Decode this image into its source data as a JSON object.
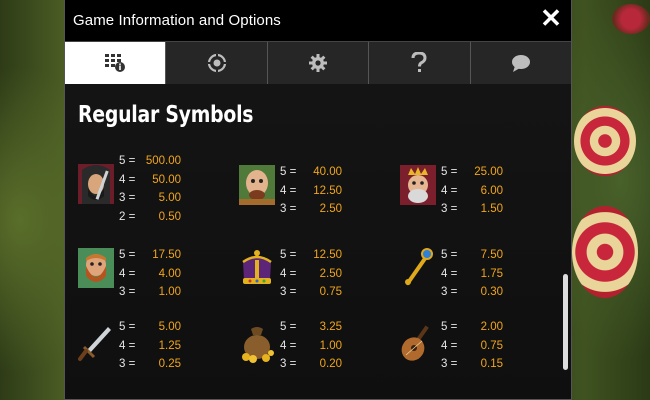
{
  "dialog": {
    "title": "Game Information and Options",
    "close_label": "✕"
  },
  "tabs": [
    {
      "name": "paytable",
      "icon": "paytable-icon",
      "active": true
    },
    {
      "name": "autoplay",
      "icon": "autoplay-icon",
      "active": false
    },
    {
      "name": "settings",
      "icon": "gear-icon",
      "active": false
    },
    {
      "name": "help",
      "icon": "question-icon",
      "active": false
    },
    {
      "name": "chat",
      "icon": "chat-bubble-icon",
      "active": false
    }
  ],
  "section": {
    "title": "Regular Symbols"
  },
  "symbols": [
    {
      "icon": "hooded-villain-symbol",
      "pays": [
        {
          "k": "5 =",
          "v": "500.00"
        },
        {
          "k": "4 =",
          "v": "50.00"
        },
        {
          "k": "3 =",
          "v": "5.00"
        },
        {
          "k": "2 =",
          "v": "0.50"
        }
      ]
    },
    {
      "icon": "bald-man-symbol",
      "pays": [
        {
          "k": "5 =",
          "v": "40.00"
        },
        {
          "k": "4 =",
          "v": "12.50"
        },
        {
          "k": "3 =",
          "v": "2.50"
        }
      ]
    },
    {
      "icon": "king-symbol",
      "pays": [
        {
          "k": "5 =",
          "v": "25.00"
        },
        {
          "k": "4 =",
          "v": "6.00"
        },
        {
          "k": "3 =",
          "v": "1.50"
        }
      ]
    },
    {
      "icon": "bearded-friar-symbol",
      "pays": [
        {
          "k": "5 =",
          "v": "17.50"
        },
        {
          "k": "4 =",
          "v": "4.00"
        },
        {
          "k": "3 =",
          "v": "1.00"
        }
      ]
    },
    {
      "icon": "crown-symbol",
      "pays": [
        {
          "k": "5 =",
          "v": "12.50"
        },
        {
          "k": "4 =",
          "v": "2.50"
        },
        {
          "k": "3 =",
          "v": "0.75"
        }
      ]
    },
    {
      "icon": "scepter-symbol",
      "pays": [
        {
          "k": "5 =",
          "v": "7.50"
        },
        {
          "k": "4 =",
          "v": "1.75"
        },
        {
          "k": "3 =",
          "v": "0.30"
        }
      ]
    },
    {
      "icon": "sword-symbol",
      "pays": [
        {
          "k": "5 =",
          "v": "5.00"
        },
        {
          "k": "4 =",
          "v": "1.25"
        },
        {
          "k": "3 =",
          "v": "0.25"
        }
      ]
    },
    {
      "icon": "gold-bag-symbol",
      "pays": [
        {
          "k": "5 =",
          "v": "3.25"
        },
        {
          "k": "4 =",
          "v": "1.00"
        },
        {
          "k": "3 =",
          "v": "0.20"
        }
      ]
    },
    {
      "icon": "lute-symbol",
      "pays": [
        {
          "k": "5 =",
          "v": "2.00"
        },
        {
          "k": "4 =",
          "v": "0.75"
        },
        {
          "k": "3 =",
          "v": "0.15"
        }
      ]
    }
  ]
}
